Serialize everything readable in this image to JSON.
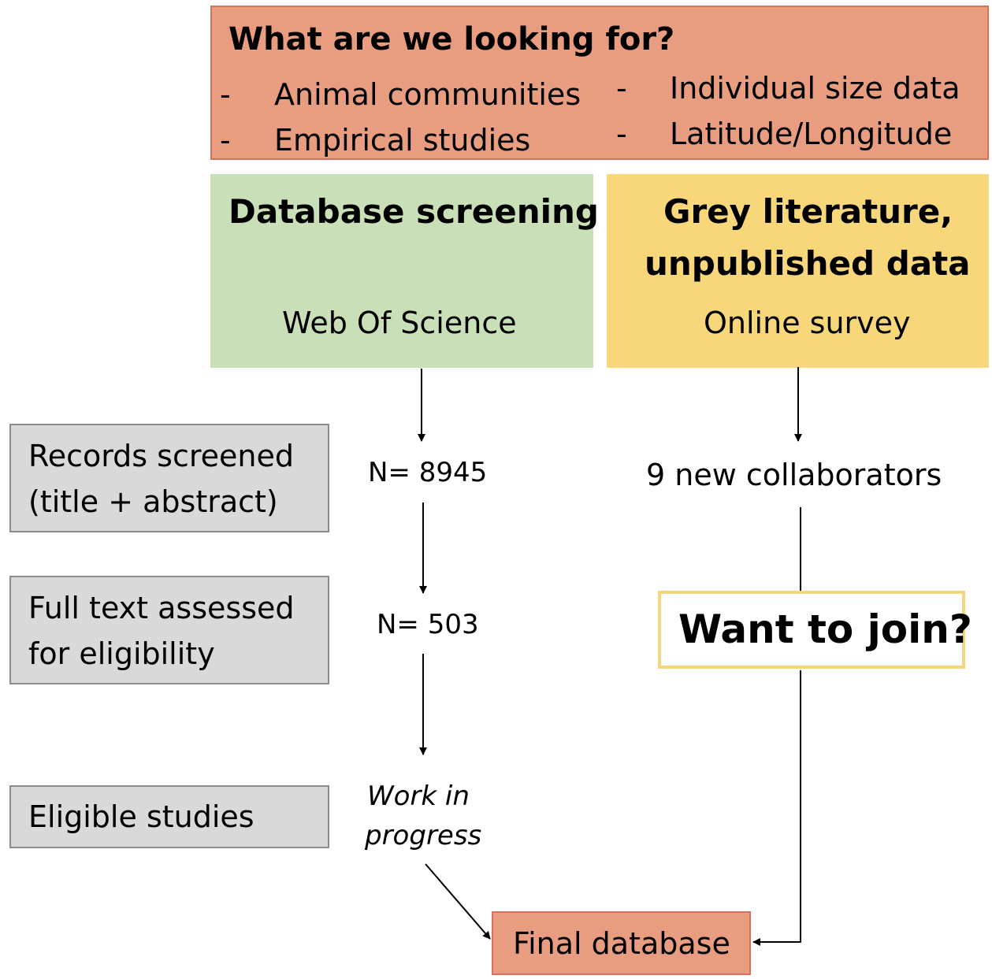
{
  "criteria_box": {
    "title": "What are we looking for?",
    "dash": "-",
    "items_left": [
      "Animal communities",
      "Empirical studies"
    ],
    "items_right": [
      "Individual size data",
      "Latitude/Longitude"
    ],
    "fill_color": "#e89d80"
  },
  "database_box": {
    "title": "Database screening",
    "source": "Web Of Science",
    "fill_color": "#c9dfb8"
  },
  "grey_box": {
    "title_line1": "Grey literature,",
    "title_line2": "unpublished data",
    "source": "Online survey",
    "fill_color": "#f8d77a"
  },
  "steps": [
    {
      "line1": "Records screened",
      "line2": "(title + abstract)"
    },
    {
      "line1": "Full text assessed",
      "line2": "for eligibility"
    },
    {
      "line1": "Eligible studies",
      "line2": ""
    }
  ],
  "counts": {
    "records": "N= 8945",
    "full_text": "N= 503",
    "eligible_line1": "Work in",
    "eligible_line2": "progress"
  },
  "grey_result": "9 new collaborators",
  "join_prompt": "Want to join?",
  "final": "Final database"
}
